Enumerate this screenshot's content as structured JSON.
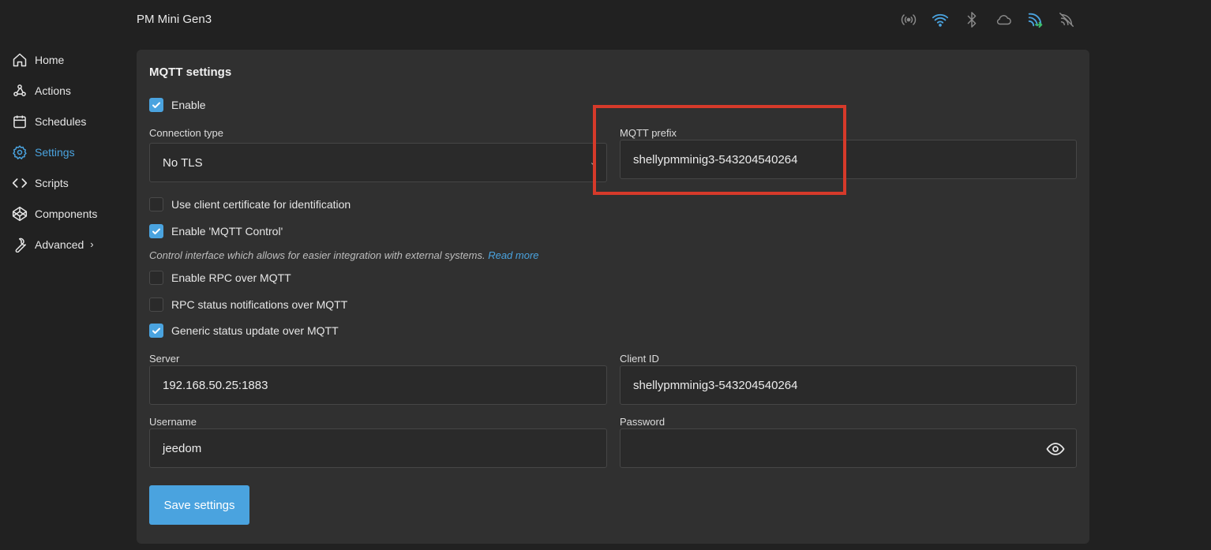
{
  "header": {
    "device_title": "PM Mini Gen3",
    "status_icons": [
      "radio-broadcast-icon",
      "wifi-icon",
      "bluetooth-icon",
      "cloud-icon",
      "mqtt-connected-icon",
      "sync-off-icon"
    ],
    "accent_color": "#4aa3df"
  },
  "sidebar": {
    "items": [
      {
        "label": "Home",
        "icon": "home-icon"
      },
      {
        "label": "Actions",
        "icon": "webhook-icon"
      },
      {
        "label": "Schedules",
        "icon": "calendar-icon"
      },
      {
        "label": "Settings",
        "icon": "gear-icon",
        "active": true
      },
      {
        "label": "Scripts",
        "icon": "code-icon"
      },
      {
        "label": "Components",
        "icon": "codepen-icon"
      },
      {
        "label": "Advanced",
        "icon": "wrench-icon",
        "expandable": true
      }
    ]
  },
  "mqtt": {
    "title": "MQTT settings",
    "enable_label": "Enable",
    "enable_checked": true,
    "connection_type_label": "Connection type",
    "connection_type_value": "No TLS",
    "prefix_label": "MQTT prefix",
    "prefix_value": "shellypmminig3-543204540264",
    "client_cert_label": "Use client certificate for identification",
    "client_cert_checked": false,
    "mqtt_control_label": "Enable 'MQTT Control'",
    "mqtt_control_checked": true,
    "hint_text": "Control interface which allows for easier integration with external systems.",
    "hint_link": "Read more",
    "rpc_label": "Enable RPC over MQTT",
    "rpc_checked": false,
    "rpc_status_label": "RPC status notifications over MQTT",
    "rpc_status_checked": false,
    "generic_status_label": "Generic status update over MQTT",
    "generic_status_checked": true,
    "server_label": "Server",
    "server_value": "192.168.50.25:1883",
    "client_id_label": "Client ID",
    "client_id_value": "shellypmminig3-543204540264",
    "username_label": "Username",
    "username_value": "jeedom",
    "password_label": "Password",
    "password_value": "",
    "save_label": "Save settings"
  },
  "annotation": {
    "highlight_color": "#d63a2a"
  }
}
